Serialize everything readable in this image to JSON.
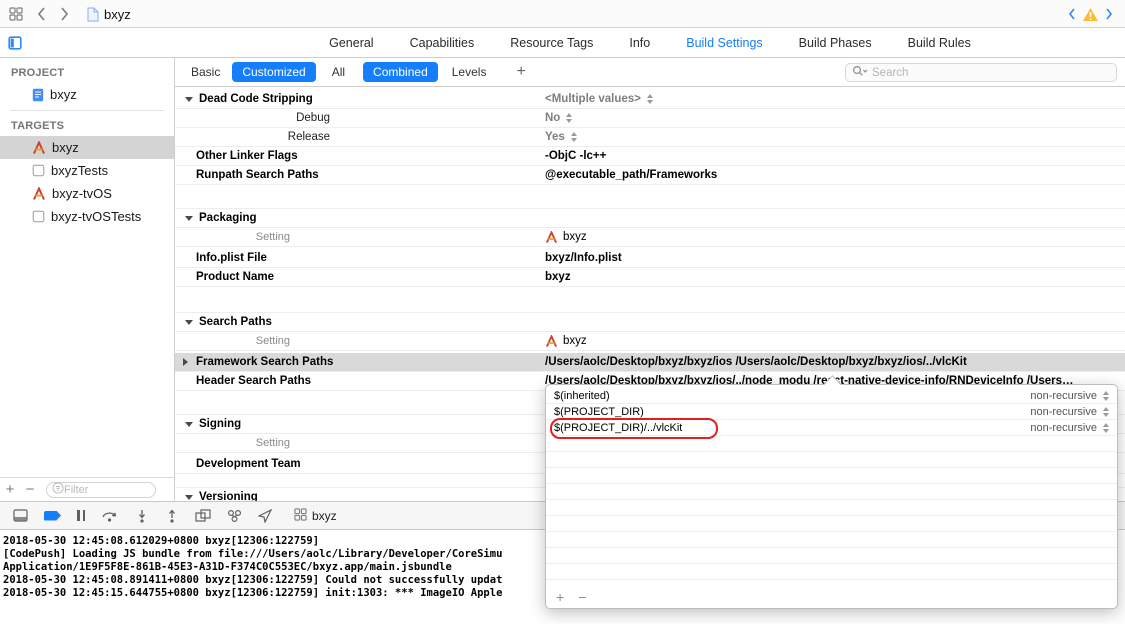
{
  "colors": {
    "accent_blue": "#157efb",
    "selection_gray": "#d4d4d4",
    "warning_yellow": "#fdbe2e",
    "annotation_red": "#e02020"
  },
  "toolbar": {
    "title": "bxyz"
  },
  "tabbar": {
    "tabs": [
      "General",
      "Capabilities",
      "Resource Tags",
      "Info",
      "Build Settings",
      "Build Phases",
      "Build Rules"
    ],
    "active": "Build Settings"
  },
  "sidebar": {
    "project_header": "PROJECT",
    "project_item": "bxyz",
    "targets_header": "TARGETS",
    "targets": [
      "bxyz",
      "bxyzTests",
      "bxyz-tvOS",
      "bxyz-tvOSTests"
    ],
    "add_label": "+",
    "remove_label": "−",
    "filter_placeholder": "Filter"
  },
  "scopebar": {
    "items": [
      "Basic",
      "Customized",
      "All",
      "Combined",
      "Levels"
    ],
    "selected": [
      "Customized",
      "Combined"
    ],
    "add_label": "+",
    "search_placeholder": "Search"
  },
  "settings": {
    "rows": [
      {
        "label": "Dead Code Stripping",
        "value": "<Multiple values>"
      },
      {
        "label": "Debug",
        "value": "No"
      },
      {
        "label": "Release",
        "value": "Yes"
      },
      {
        "label": "Other Linker Flags",
        "value": "-ObjC -lc++"
      },
      {
        "label": "Runpath Search Paths",
        "value": "@executable_path/Frameworks"
      },
      {
        "label": "Packaging"
      },
      {
        "label": "Setting",
        "value": "bxyz"
      },
      {
        "label": "Info.plist File",
        "value": "bxyz/Info.plist"
      },
      {
        "label": "Product Name",
        "value": "bxyz"
      },
      {
        "label": "Search Paths"
      },
      {
        "label": "Setting",
        "value": "bxyz"
      },
      {
        "label": "Framework Search Paths",
        "value": "/Users/aolc/Desktop/bxyz/bxyz/ios /Users/aolc/Desktop/bxyz/bxyz/ios/../vlcKit"
      },
      {
        "label": "Header Search Paths",
        "value": "/Users/aolc/Desktop/bxyz/bxyz/ios/../node_modu /react-native-device-info/RNDeviceInfo /Users…"
      },
      {
        "label": "Signing"
      },
      {
        "label": "Setting",
        "value": ""
      },
      {
        "label": "Development Team",
        "value": ""
      },
      {
        "label": "Versioning"
      }
    ]
  },
  "popover": {
    "rows": [
      {
        "path": "$(inherited)",
        "mode": "non-recursive"
      },
      {
        "path": "$(PROJECT_DIR)",
        "mode": "non-recursive"
      },
      {
        "path": "$(PROJECT_DIR)/../vlcKit",
        "mode": "non-recursive",
        "annotated": true
      }
    ],
    "annotation": "red-oval-highlight",
    "add_label": "+",
    "remove_label": "−"
  },
  "debugbar": {
    "process": "bxyz"
  },
  "console": {
    "lines": [
      "2018-05-30 12:45:08.612029+0800 bxyz[12306:122759]",
      "[CodePush] Loading JS bundle from file:///Users/aolc/Library/Developer/CoreSimu",
      "Application/1E9F5F8E-861B-45E3-A31D-F374C0C553EC/bxyz.app/main.jsbundle",
      "2018-05-30 12:45:08.891411+0800 bxyz[12306:122759] Could not successfully updat",
      "2018-05-30 12:45:15.644755+0800 bxyz[12306:122759] init:1303: *** ImageIO Apple"
    ]
  },
  "icons": {
    "toolbar": [
      "window-grid-icon",
      "back-chevron-icon",
      "forward-chevron-icon",
      "document-icon",
      "prev-issue-icon",
      "warning-icon",
      "next-issue-icon"
    ],
    "debugbar": [
      "hide-debug-area-icon",
      "breakpoints-toggle-icon",
      "pause-icon",
      "step-over-icon",
      "step-into-icon",
      "step-out-icon",
      "view-debugger-icon",
      "memory-graph-icon",
      "simulate-location-icon",
      "process-grid-icon"
    ]
  }
}
